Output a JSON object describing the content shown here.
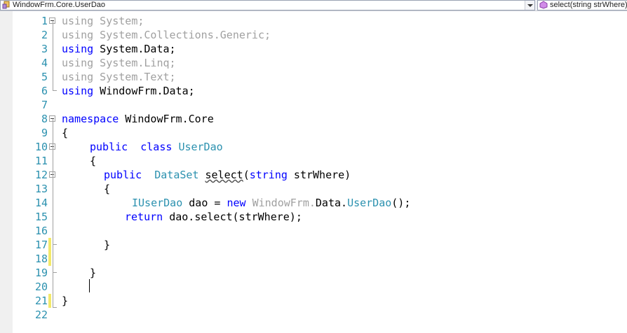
{
  "nav_bar": {
    "type_combo": "WindowFrm.Core.UserDao",
    "member_combo": "select(string strWhere)"
  },
  "lines": [
    {
      "num": "1",
      "tokens": [
        {
          "t": "using System;",
          "c": "gr"
        }
      ]
    },
    {
      "num": "2",
      "tokens": [
        {
          "t": "using System.Collections.Generic;",
          "c": "gr"
        }
      ]
    },
    {
      "num": "3",
      "tokens": [
        {
          "t": "using",
          "c": "kw"
        },
        {
          "t": " System.Data;",
          "c": ""
        }
      ]
    },
    {
      "num": "4",
      "tokens": [
        {
          "t": "using System.Linq;",
          "c": "gr"
        }
      ]
    },
    {
      "num": "5",
      "tokens": [
        {
          "t": "using System.Text;",
          "c": "gr"
        }
      ]
    },
    {
      "num": "6",
      "tokens": [
        {
          "t": "using",
          "c": "kw"
        },
        {
          "t": " WindowFrm.Data;",
          "c": ""
        }
      ]
    },
    {
      "num": "7",
      "tokens": []
    },
    {
      "num": "8",
      "tokens": [
        {
          "t": "namespace",
          "c": "kw"
        },
        {
          "t": " WindowFrm.Core",
          "c": ""
        }
      ]
    },
    {
      "num": "9",
      "tokens": [
        {
          "t": "{",
          "c": ""
        }
      ]
    },
    {
      "num": "10",
      "tokens": [
        {
          "t": "public",
          "c": "kw"
        },
        {
          "t": "  ",
          "c": ""
        },
        {
          "t": "class",
          "c": "kw"
        },
        {
          "t": " ",
          "c": ""
        },
        {
          "t": "UserDao",
          "c": "ty"
        }
      ]
    },
    {
      "num": "11",
      "tokens": [
        {
          "t": "{",
          "c": ""
        }
      ]
    },
    {
      "num": "12",
      "tokens": [
        {
          "t": "public",
          "c": "kw"
        },
        {
          "t": "  ",
          "c": ""
        },
        {
          "t": "DataSet",
          "c": "ty"
        },
        {
          "t": " ",
          "c": ""
        },
        {
          "t": "select",
          "c": "sq"
        },
        {
          "t": "(",
          "c": ""
        },
        {
          "t": "string",
          "c": "kw"
        },
        {
          "t": " strWhere)",
          "c": ""
        }
      ]
    },
    {
      "num": "13",
      "tokens": [
        {
          "t": "{",
          "c": ""
        }
      ]
    },
    {
      "num": "14",
      "tokens": [
        {
          "t": "IUserDao",
          "c": "ty"
        },
        {
          "t": " dao = ",
          "c": ""
        },
        {
          "t": "new",
          "c": "kw"
        },
        {
          "t": " ",
          "c": ""
        },
        {
          "t": "WindowFrm.",
          "c": "gr"
        },
        {
          "t": "Data.",
          "c": ""
        },
        {
          "t": "UserDao",
          "c": "ty"
        },
        {
          "t": "();",
          "c": ""
        }
      ]
    },
    {
      "num": "15",
      "tokens": [
        {
          "t": "return",
          "c": "kw"
        },
        {
          "t": " dao.select(strWhere);",
          "c": ""
        }
      ]
    },
    {
      "num": "16",
      "tokens": []
    },
    {
      "num": "17",
      "tokens": [
        {
          "t": "}",
          "c": ""
        }
      ]
    },
    {
      "num": "18",
      "tokens": []
    },
    {
      "num": "19",
      "tokens": [
        {
          "t": "}",
          "c": ""
        }
      ]
    },
    {
      "num": "20",
      "tokens": []
    },
    {
      "num": "21",
      "tokens": [
        {
          "t": "}",
          "c": ""
        }
      ]
    },
    {
      "num": "22",
      "tokens": []
    }
  ]
}
